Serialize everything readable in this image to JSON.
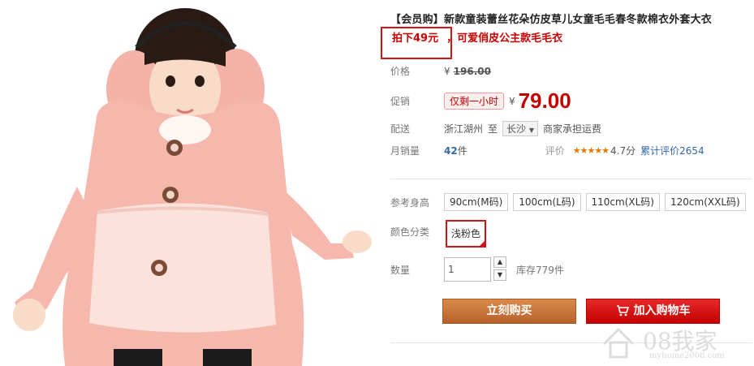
{
  "product": {
    "title": "【会员购】新款童装蕾丝花朵仿皮草儿女童毛毛春冬款棉衣外套大衣",
    "promo_highlight": "拍下49元",
    "promo_rest": "，可爱俏皮公主款毛毛衣"
  },
  "price": {
    "label": "价格",
    "currency": "¥",
    "original": "196.00"
  },
  "sale": {
    "label": "促销",
    "tag": "仅剩一小时",
    "currency": "¥",
    "price": "79.00"
  },
  "shipping": {
    "label": "配送",
    "from": "浙江湖州",
    "to_word": "至",
    "destination": "长沙",
    "note": "商家承担运费"
  },
  "sales": {
    "label": "月销量",
    "count": "42",
    "unit": "件",
    "rating_label": "评价",
    "stars": "★★★★★",
    "score": "4.7分",
    "total_reviews": "累计评价2654"
  },
  "size": {
    "label": "参考身高",
    "options": [
      "90cm(M码)",
      "100cm(L码)",
      "110cm(XL码)",
      "120cm(XXL码)"
    ]
  },
  "color": {
    "label": "颜色分类",
    "selected": "浅粉色"
  },
  "quantity": {
    "label": "数量",
    "value": "1",
    "stock": "库存779件",
    "up": "▲",
    "down": "▼"
  },
  "actions": {
    "buy_now": "立刻购买",
    "add_cart": "加入购物车"
  },
  "watermark": {
    "text": "08我家",
    "url": "myhome2008.com"
  },
  "colors": {
    "accent_red": "#c40000",
    "buy_orange": "#c8733a",
    "coat_pink": "#f6b8ac"
  }
}
